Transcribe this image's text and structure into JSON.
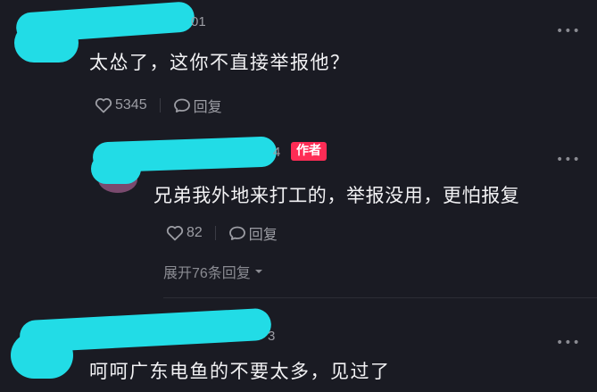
{
  "comments": [
    {
      "username_trail": "01",
      "text": "太怂了，这你不直接举报他？",
      "likes": "5345",
      "reply_label": "回复",
      "more": "•••"
    },
    {
      "username_trail": "4",
      "author_badge": "作者",
      "text": "兄弟我外地来打工的，举报没用，更怕报复",
      "likes": "82",
      "reply_label": "回复",
      "more": "•••",
      "expand_label": "展开76条回复"
    },
    {
      "username_trail": "3",
      "text": "呵呵广东电鱼的不要太多，见过了",
      "more": "•••"
    }
  ],
  "colors": {
    "background": "#1a1b23",
    "redaction": "#22dce6",
    "author_badge": "#fe2c55"
  },
  "icons": [
    "heart-icon",
    "comment-bubble-icon",
    "more-dots-icon",
    "chevron-down-icon"
  ]
}
